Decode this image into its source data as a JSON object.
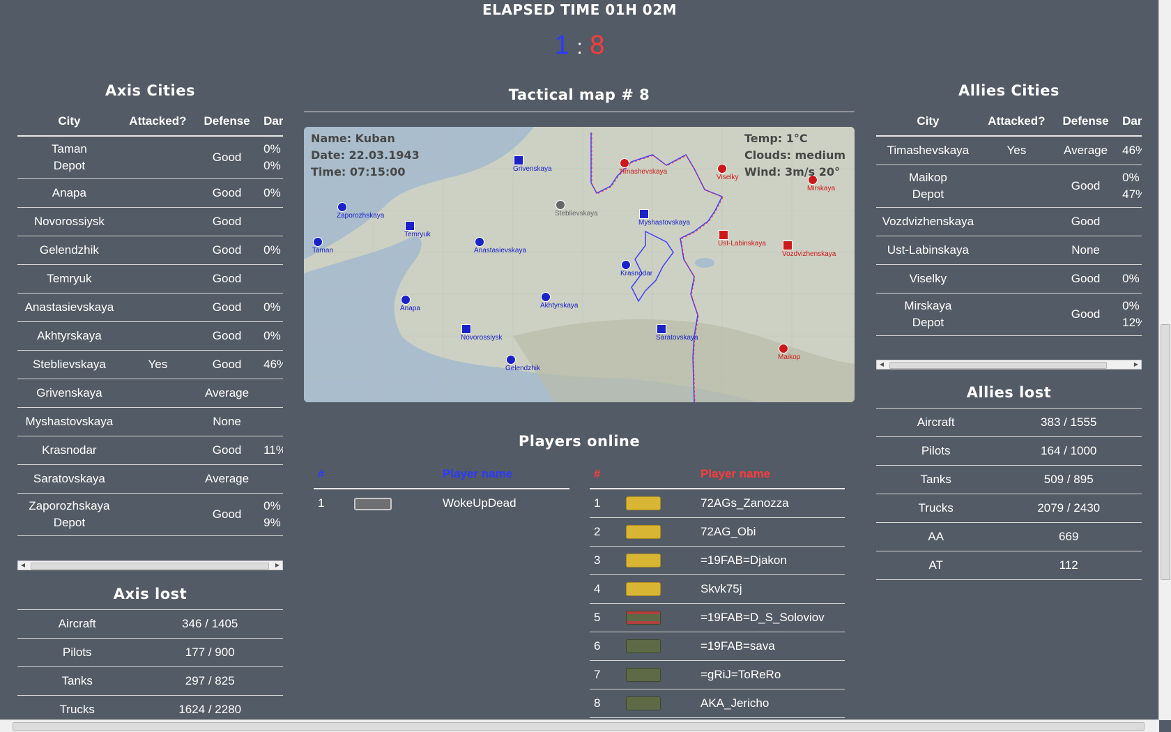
{
  "header": {
    "elapsed": "ELAPSED TIME 01H 02M",
    "score_axis": "1",
    "score_sep": ":",
    "score_allies": "8"
  },
  "axis_cities": {
    "title": "Axis Cities",
    "headers": [
      "City",
      "Attacked?",
      "Defense",
      "Damag"
    ],
    "rows": [
      {
        "city": [
          "Taman",
          "Depot"
        ],
        "attacked": "",
        "defense": "Good",
        "damage": [
          "0%",
          "0%"
        ]
      },
      {
        "city": [
          "Anapa"
        ],
        "attacked": "",
        "defense": "Good",
        "damage": [
          "0%"
        ]
      },
      {
        "city": [
          "Novorossiysk"
        ],
        "attacked": "",
        "defense": "Good",
        "damage": [
          ""
        ]
      },
      {
        "city": [
          "Gelendzhik"
        ],
        "attacked": "",
        "defense": "Good",
        "damage": [
          "0%"
        ]
      },
      {
        "city": [
          "Temryuk"
        ],
        "attacked": "",
        "defense": "Good",
        "damage": [
          ""
        ]
      },
      {
        "city": [
          "Anastasievskaya"
        ],
        "attacked": "",
        "defense": "Good",
        "damage": [
          "0%"
        ]
      },
      {
        "city": [
          "Akhtyrskaya"
        ],
        "attacked": "",
        "defense": "Good",
        "damage": [
          "0%"
        ]
      },
      {
        "city": [
          "Steblievskaya"
        ],
        "attacked": "Yes",
        "defense": "Good",
        "damage": [
          "46%"
        ]
      },
      {
        "city": [
          "Grivenskaya"
        ],
        "attacked": "",
        "defense": "Average",
        "damage": [
          ""
        ]
      },
      {
        "city": [
          "Myshastovskaya"
        ],
        "attacked": "",
        "defense": "None",
        "damage": [
          ""
        ]
      },
      {
        "city": [
          "Krasnodar"
        ],
        "attacked": "",
        "defense": "Good",
        "damage": [
          "11%"
        ]
      },
      {
        "city": [
          "Saratovskaya"
        ],
        "attacked": "",
        "defense": "Average",
        "damage": [
          ""
        ]
      },
      {
        "city": [
          "Zaporozhskaya",
          "Depot"
        ],
        "attacked": "",
        "defense": "Good",
        "damage": [
          "0%",
          "9%"
        ]
      }
    ]
  },
  "axis_lost": {
    "title": "Axis lost",
    "rows": [
      {
        "label": "Aircraft",
        "value": "346 / 1405"
      },
      {
        "label": "Pilots",
        "value": "177 / 900"
      },
      {
        "label": "Tanks",
        "value": "297 / 825"
      },
      {
        "label": "Trucks",
        "value": "1624 / 2280"
      }
    ]
  },
  "allies_cities": {
    "title": "Allies Cities",
    "headers": [
      "City",
      "Attacked?",
      "Defense",
      "Dama"
    ],
    "rows": [
      {
        "city": [
          "Timashevskaya"
        ],
        "attacked": "Yes",
        "defense": "Average",
        "damage": [
          "46%"
        ]
      },
      {
        "city": [
          "Maikop",
          "Depot"
        ],
        "attacked": "",
        "defense": "Good",
        "damage": [
          "0%",
          "47%"
        ]
      },
      {
        "city": [
          "Vozdvizhenskaya"
        ],
        "attacked": "",
        "defense": "Good",
        "damage": [
          ""
        ]
      },
      {
        "city": [
          "Ust-Labinskaya"
        ],
        "attacked": "",
        "defense": "None",
        "damage": [
          ""
        ]
      },
      {
        "city": [
          "Viselky"
        ],
        "attacked": "",
        "defense": "Good",
        "damage": [
          "0%"
        ]
      },
      {
        "city": [
          "Mirskaya",
          "Depot"
        ],
        "attacked": "",
        "defense": "Good",
        "damage": [
          "0%",
          "12%"
        ]
      }
    ]
  },
  "allies_lost": {
    "title": "Allies lost",
    "rows": [
      {
        "label": "Aircraft",
        "value": "383 / 1555"
      },
      {
        "label": "Pilots",
        "value": "164 / 1000"
      },
      {
        "label": "Tanks",
        "value": "509 / 895"
      },
      {
        "label": "Trucks",
        "value": "2079 / 2430"
      },
      {
        "label": "AA",
        "value": "669"
      },
      {
        "label": "AT",
        "value": "112"
      }
    ]
  },
  "map": {
    "title": "Tactical map # 8",
    "name": "Name: Kuban",
    "date": "Date: 22.03.1943",
    "time": "Time: 07:15:00",
    "temp": "Temp: 1°C",
    "clouds": "Clouds: medium",
    "wind": "Wind: 3m/s 20°",
    "labels": [
      "Grivenskaya",
      "Timashevskaya",
      "Viselky",
      "Mirskaya",
      "Zaporozhskaya",
      "Steblievskaya",
      "Myshastovskaya",
      "Temryuk",
      "Taman",
      "Anastasievskaya",
      "Ust-Labinskaya",
      "Vozdvizhenskaya",
      "Krasnodar",
      "Anapa",
      "Akhtyrskaya",
      "Novorossiysk",
      "Saratovskaya",
      "Gelendzhik",
      "Maikop"
    ]
  },
  "players": {
    "title": "Players online",
    "axis_header": {
      "num": "#",
      "name": "Player name"
    },
    "allies_header": {
      "num": "#",
      "name": "Player name"
    },
    "axis": [
      {
        "num": "1",
        "name": "WokeUpDead"
      }
    ],
    "allies": [
      {
        "num": "1",
        "name": "72AGs_Zanozza",
        "rank": "gold"
      },
      {
        "num": "2",
        "name": "72AG_Obi",
        "rank": "gold"
      },
      {
        "num": "3",
        "name": "=19FAB=Djakon",
        "rank": "gold"
      },
      {
        "num": "4",
        "name": "Skvk75j",
        "rank": "gold"
      },
      {
        "num": "5",
        "name": "=19FAB=D_S_Soloviov",
        "rank": "green-red"
      },
      {
        "num": "6",
        "name": "=19FAB=sava",
        "rank": "green"
      },
      {
        "num": "7",
        "name": "=gRiJ=ToReRo",
        "rank": "green"
      },
      {
        "num": "8",
        "name": "AKA_Jericho",
        "rank": "green"
      }
    ]
  },
  "colors": {
    "background": "#535b66",
    "axis_blue": "#2b3bff",
    "allies_red": "#ff3b3b",
    "map_water": "#a9bdcc",
    "map_land": "#cfd3c4"
  }
}
